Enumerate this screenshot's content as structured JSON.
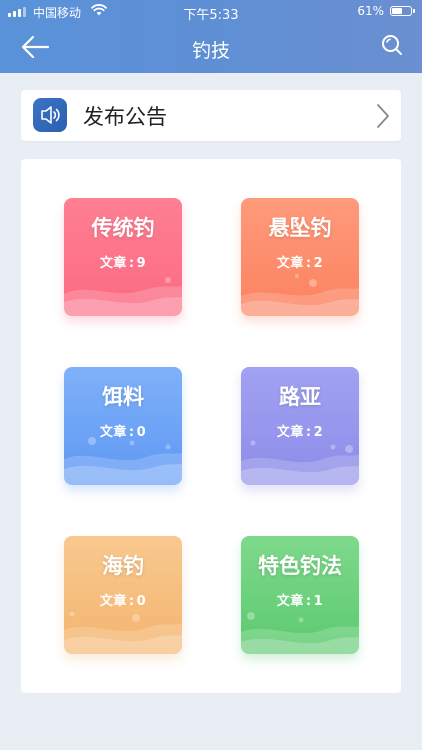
{
  "status_bar": {
    "carrier": "中国移动",
    "time": "下午5:33",
    "battery": "61%",
    "battery_level": 0.61
  },
  "header": {
    "title": "钓技",
    "back_icon": "arrow-left-icon",
    "search_icon": "search-icon"
  },
  "notice": {
    "label": "发布公告",
    "icon": "speaker-icon",
    "arrow_icon": "chevron-right-icon"
  },
  "categories": [
    {
      "name": "传统钓",
      "count_label": "文章",
      "count": "9",
      "color": "#fb6a82"
    },
    {
      "name": "悬坠钓",
      "count_label": "文章",
      "count": "2",
      "color": "#fb8260"
    },
    {
      "name": "饵料",
      "count_label": "文章",
      "count": "0",
      "color": "#5e98f3"
    },
    {
      "name": "路亚",
      "count_label": "文章",
      "count": "2",
      "color": "#8c8ce8"
    },
    {
      "name": "海钓",
      "count_label": "文章",
      "count": "0",
      "color": "#f4b46f"
    },
    {
      "name": "特色钓法",
      "count_label": "文章",
      "count": "1",
      "color": "#5cc96e"
    }
  ],
  "colors": {
    "header": "#5e8fd5",
    "background": "#e9eef5"
  }
}
